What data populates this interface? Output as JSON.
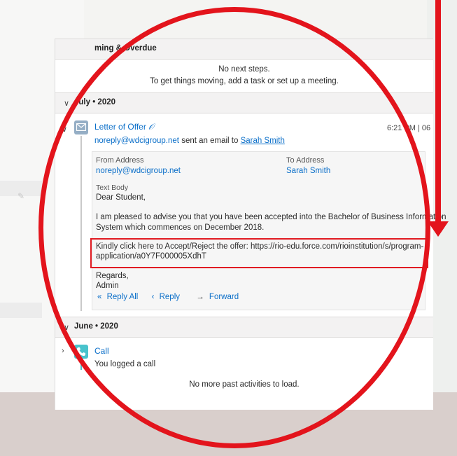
{
  "upcoming": {
    "heading": "ming & Overdue",
    "no_steps": "No next steps.",
    "hint": "To get things moving, add a task or set up a meeting."
  },
  "july": {
    "heading": "July • 2020",
    "email": {
      "title": "Letter of Offer",
      "sender": "noreply@wdcigroup.net",
      "action_text": "sent an email to",
      "recipient": "Sarah Smith",
      "timestamp": "6:21 PM | 06",
      "from_label": "From Address",
      "from_value": "noreply@wdcigroup.net",
      "to_label": "To Address",
      "to_value": "Sarah Smith",
      "text_body_label": "Text Body",
      "greeting": "Dear Student,",
      "para1_line1": "I am pleased to advise you that you have been accepted into the Bachelor of Business Information",
      "para1_line2": "System which commences on December 2018.",
      "para2_line1": "Kindly click here to Accept/Reject the offer: https://rio-edu.force.com/rioinstitution/s/program-",
      "para2_line2": "application/a0Y7F000005XdhT",
      "regards": "Regards,",
      "signature": "Admin"
    },
    "actions": {
      "reply_all": "Reply All",
      "reply": "Reply",
      "forward": "Forward"
    }
  },
  "june": {
    "heading": "June • 2020",
    "call": {
      "title": "Call",
      "subtitle": "You logged a call"
    }
  },
  "footer": {
    "no_more": "No more past activities to load."
  },
  "colors": {
    "annotation_red": "#e3141c",
    "link_blue": "#0b6fc9",
    "email_icon": "#95aec5",
    "call_icon": "#48c3cc"
  }
}
